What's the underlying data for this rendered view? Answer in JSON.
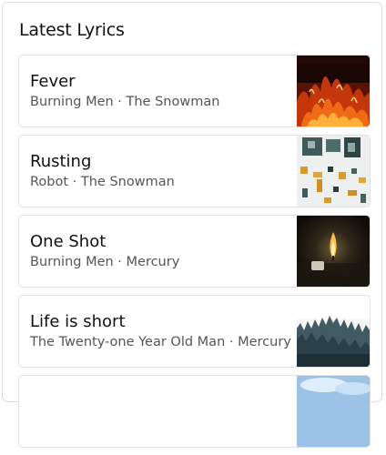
{
  "widget": {
    "title": "Latest Lyrics"
  },
  "lyrics": [
    {
      "title": "Fever",
      "subtitle": "Burning Men · The Snowman",
      "thumbnail_icon": "fire-photo-icon"
    },
    {
      "title": "Rusting",
      "subtitle": "Robot · The Snowman",
      "thumbnail_icon": "robot-parts-photo-icon"
    },
    {
      "title": "One Shot",
      "subtitle": "Burning Men · Mercury",
      "thumbnail_icon": "candle-photo-icon"
    },
    {
      "title": "Life is short",
      "subtitle": "The Twenty-one Year Old Man · Mercury",
      "thumbnail_icon": "forest-photo-icon"
    },
    {
      "title": "",
      "subtitle": "",
      "thumbnail_icon": "sky-photo-icon"
    }
  ]
}
